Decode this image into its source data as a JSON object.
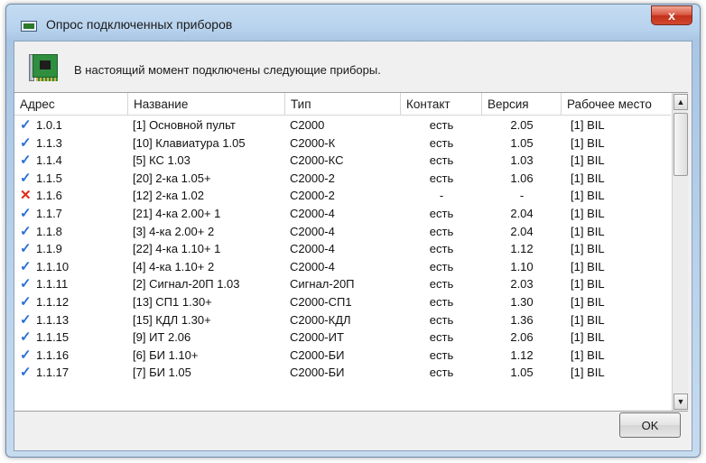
{
  "window": {
    "title": "Опрос подключенных приборов",
    "close_label": "x"
  },
  "info": {
    "message": "В настоящий момент подключены следующие приборы."
  },
  "table": {
    "columns": [
      "Адрес",
      "Название",
      "Тип",
      "Контакт",
      "Версия",
      "Рабочее место"
    ],
    "rows": [
      {
        "status": "ok",
        "addr": "1.0.1",
        "name": "[1] Основной пульт",
        "type": "С2000",
        "contact": "есть",
        "version": "2.05",
        "workplace": "[1] BIL"
      },
      {
        "status": "ok",
        "addr": "1.1.3",
        "name": "[10] Клавиатура 1.05",
        "type": "С2000-К",
        "contact": "есть",
        "version": "1.05",
        "workplace": "[1] BIL"
      },
      {
        "status": "ok",
        "addr": "1.1.4",
        "name": "[5] КС 1.03",
        "type": "С2000-КС",
        "contact": "есть",
        "version": "1.03",
        "workplace": "[1] BIL"
      },
      {
        "status": "ok",
        "addr": "1.1.5",
        "name": "[20] 2-ка 1.05+",
        "type": "С2000-2",
        "contact": "есть",
        "version": "1.06",
        "workplace": "[1] BIL"
      },
      {
        "status": "bad",
        "addr": "1.1.6",
        "name": "[12] 2-ка 1.02",
        "type": "С2000-2",
        "contact": "-",
        "version": "-",
        "workplace": "[1] BIL"
      },
      {
        "status": "ok",
        "addr": "1.1.7",
        "name": "[21] 4-ка 2.00+ 1",
        "type": "С2000-4",
        "contact": "есть",
        "version": "2.04",
        "workplace": "[1] BIL"
      },
      {
        "status": "ok",
        "addr": "1.1.8",
        "name": "[3] 4-ка 2.00+ 2",
        "type": "С2000-4",
        "contact": "есть",
        "version": "2.04",
        "workplace": "[1] BIL"
      },
      {
        "status": "ok",
        "addr": "1.1.9",
        "name": "[22] 4-ка 1.10+ 1",
        "type": "С2000-4",
        "contact": "есть",
        "version": "1.12",
        "workplace": "[1] BIL"
      },
      {
        "status": "ok",
        "addr": "1.1.10",
        "name": "[4] 4-ка 1.10+ 2",
        "type": "С2000-4",
        "contact": "есть",
        "version": "1.10",
        "workplace": "[1] BIL"
      },
      {
        "status": "ok",
        "addr": "1.1.11",
        "name": "[2] Сигнал-20П 1.03",
        "type": "Сигнал-20П",
        "contact": "есть",
        "version": "2.03",
        "workplace": "[1] BIL"
      },
      {
        "status": "ok",
        "addr": "1.1.12",
        "name": "[13] СП1 1.30+",
        "type": "С2000-СП1",
        "contact": "есть",
        "version": "1.30",
        "workplace": "[1] BIL"
      },
      {
        "status": "ok",
        "addr": "1.1.13",
        "name": "[15] КДЛ 1.30+",
        "type": "С2000-КДЛ",
        "contact": "есть",
        "version": "1.36",
        "workplace": "[1] BIL"
      },
      {
        "status": "ok",
        "addr": "1.1.15",
        "name": "[9] ИТ 2.06",
        "type": "С2000-ИТ",
        "contact": "есть",
        "version": "2.06",
        "workplace": "[1] BIL"
      },
      {
        "status": "ok",
        "addr": "1.1.16",
        "name": "[6] БИ 1.10+",
        "type": "С2000-БИ",
        "contact": "есть",
        "version": "1.12",
        "workplace": "[1] BIL"
      },
      {
        "status": "ok",
        "addr": "1.1.17",
        "name": "[7] БИ 1.05",
        "type": "С2000-БИ",
        "contact": "есть",
        "version": "1.05",
        "workplace": "[1] BIL"
      }
    ]
  },
  "buttons": {
    "ok_label": "OK"
  },
  "colors": {
    "ok_check": "#2a6fd6",
    "error_cross": "#e0281a"
  },
  "icons": {
    "ok": "checkmark-icon",
    "bad": "cross-icon"
  }
}
